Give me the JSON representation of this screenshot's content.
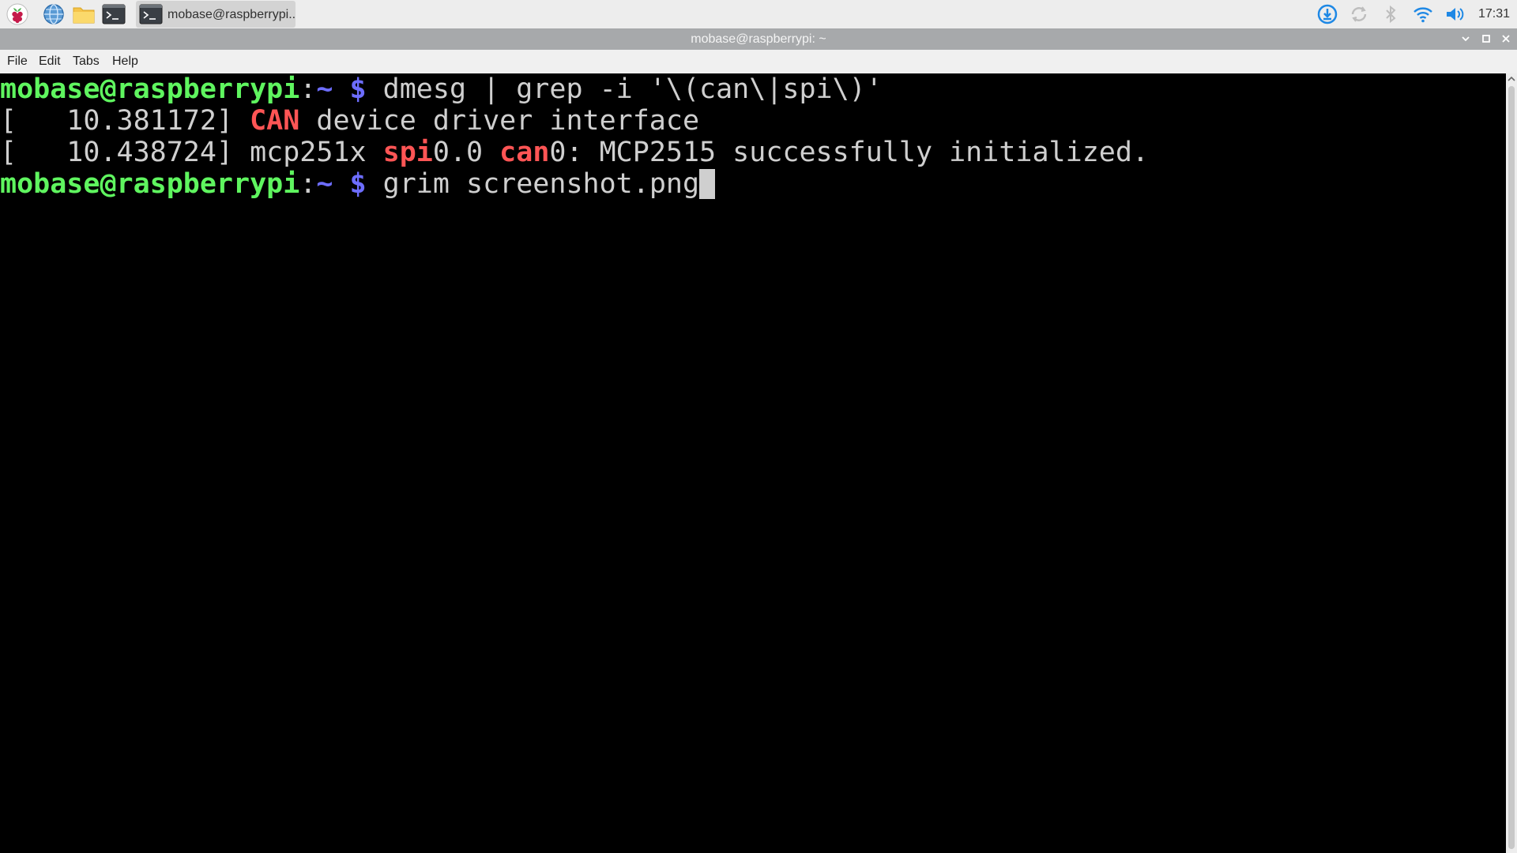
{
  "taskbar": {
    "launchers": [
      {
        "icon": "raspberry-menu-icon"
      },
      {
        "icon": "web-browser-icon"
      },
      {
        "icon": "file-manager-icon"
      },
      {
        "icon": "terminal-icon"
      }
    ],
    "task_button_label": "mobase@raspberrypi..",
    "tray_icons": [
      "download-update-icon",
      "sync-icon",
      "bluetooth-icon",
      "wifi-icon",
      "volume-icon"
    ],
    "clock": "17:31"
  },
  "window": {
    "title": "mobase@raspberrypi: ~",
    "controls": [
      "minimize-icon",
      "maximize-icon",
      "close-icon"
    ]
  },
  "menu": {
    "file": "File",
    "edit": "Edit",
    "tabs": "Tabs",
    "help": "Help"
  },
  "terminal": {
    "line1": {
      "prompt_user": "mobase@raspberrypi",
      "prompt_sep": ":",
      "prompt_dir": "~ $",
      "command": " dmesg | grep -i '\\(can\\|spi\\)'"
    },
    "line2": {
      "timestamp": "[   10.381172] ",
      "match": "CAN",
      "rest": " device driver interface"
    },
    "line3": {
      "timestamp": "[   10.438724] mcp251x ",
      "match1": "spi",
      "mid": "0.0 ",
      "match2": "can",
      "rest": "0: MCP2515 successfully initialized."
    },
    "line4": {
      "prompt_user": "mobase@raspberrypi",
      "prompt_sep": ":",
      "prompt_dir": "~ $",
      "command": " grim screenshot.png"
    },
    "colors": {
      "user": "#5ff55f",
      "dir": "#6d6dff",
      "match": "#ff5555",
      "text": "#cfcfcf",
      "background": "#000000"
    }
  }
}
